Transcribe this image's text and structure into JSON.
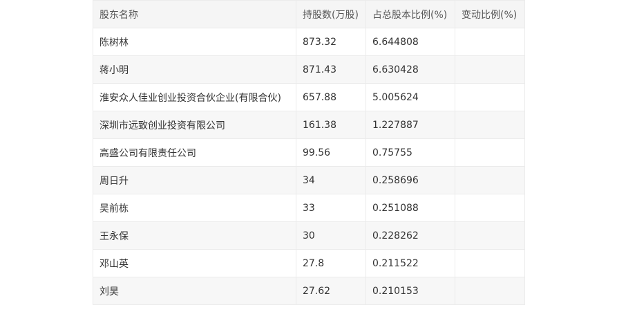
{
  "table": {
    "headers": [
      "股东名称",
      "持股数(万股)",
      "占总股本比例(%)",
      "变动比例(%)"
    ],
    "rows": [
      [
        "陈树林",
        "873.32",
        "6.644808",
        ""
      ],
      [
        "蒋小明",
        "871.43",
        "6.630428",
        ""
      ],
      [
        "淮安众人佳业创业投资合伙企业(有限合伙)",
        "657.88",
        "5.005624",
        ""
      ],
      [
        "深圳市远致创业投资有限公司",
        "161.38",
        "1.227887",
        ""
      ],
      [
        "高盛公司有限责任公司",
        "99.56",
        "0.75755",
        ""
      ],
      [
        "周日升",
        "34",
        "0.258696",
        ""
      ],
      [
        "吴前栋",
        "33",
        "0.251088",
        ""
      ],
      [
        "王永保",
        "30",
        "0.228262",
        ""
      ],
      [
        "邓山英",
        "27.8",
        "0.211522",
        ""
      ],
      [
        "刘昊",
        "27.62",
        "0.210153",
        ""
      ]
    ]
  }
}
